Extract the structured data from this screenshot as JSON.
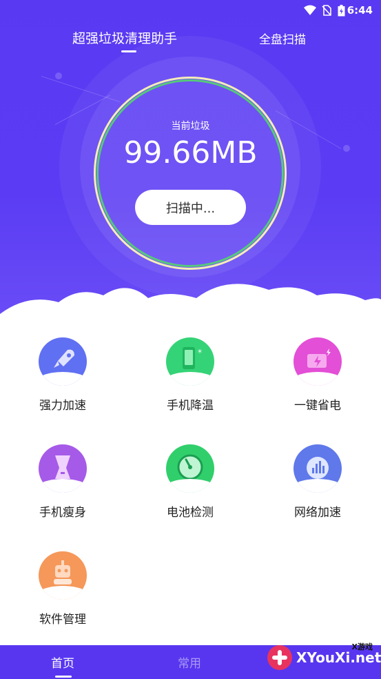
{
  "status_bar": {
    "time": "6:44",
    "icons": [
      "wifi-icon",
      "no-sim-icon",
      "battery-charging-icon"
    ]
  },
  "header": {
    "tabs": [
      {
        "label": "超强垃圾清理助手",
        "active": true
      },
      {
        "label": "全盘扫描",
        "active": false
      }
    ]
  },
  "scan": {
    "label": "当前垃圾",
    "value": "99.66MB",
    "button_label": "扫描中..."
  },
  "features": [
    {
      "label": "强力加速",
      "icon": "rocket-icon",
      "color": "#5f6cf0"
    },
    {
      "label": "手机降温",
      "icon": "thermometer-phone-icon",
      "color": "#34d377"
    },
    {
      "label": "一键省电",
      "icon": "battery-bolt-icon",
      "color": "#e64dd4"
    },
    {
      "label": "手机瘦身",
      "icon": "slim-phone-icon",
      "color": "#a65ae8"
    },
    {
      "label": "电池检测",
      "icon": "gauge-icon",
      "color": "#2fcf6a"
    },
    {
      "label": "网络加速",
      "icon": "signal-bars-icon",
      "color": "#5f78ea"
    },
    {
      "label": "软件管理",
      "icon": "robot-icon",
      "color": "#f59659"
    }
  ],
  "bottom_nav": {
    "items": [
      {
        "label": "首页",
        "active": true
      },
      {
        "label": "常用",
        "active": false
      }
    ]
  },
  "watermark": {
    "top": "X游戏",
    "main": "XYouXi.net"
  },
  "colors": {
    "primary": "#5a39f2",
    "ring_outer": "#f5eeb6",
    "ring_inner": "#56c97a"
  }
}
